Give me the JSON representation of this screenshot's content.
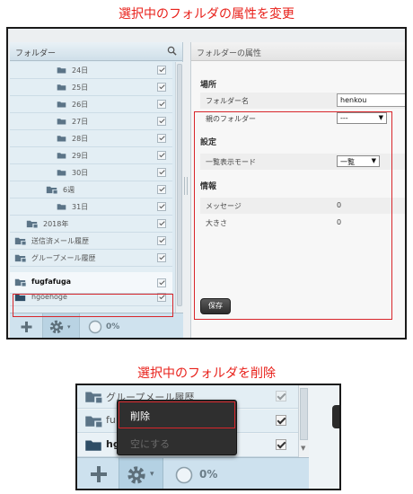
{
  "captions": {
    "top": "選択中のフォルダの属性を変更",
    "bottom": "選択中のフォルダを削除"
  },
  "left_panel": {
    "title": "フォルダー",
    "items": [
      {
        "label": "24日",
        "indent": 2,
        "icon": "folder",
        "checked": true
      },
      {
        "label": "25日",
        "indent": 2,
        "icon": "folder",
        "checked": true
      },
      {
        "label": "26日",
        "indent": 2,
        "icon": "folder",
        "checked": true
      },
      {
        "label": "27日",
        "indent": 2,
        "icon": "folder",
        "checked": true
      },
      {
        "label": "28日",
        "indent": 2,
        "icon": "folder",
        "checked": true
      },
      {
        "label": "29日",
        "indent": 2,
        "icon": "folder",
        "checked": true
      },
      {
        "label": "30日",
        "indent": 2,
        "icon": "folder",
        "checked": true
      },
      {
        "label": "6週",
        "indent": 1,
        "icon": "folder-group",
        "checked": true
      },
      {
        "label": "31日",
        "indent": 2,
        "icon": "folder",
        "checked": true
      },
      {
        "label": "2018年",
        "indent": 0,
        "icon": "folder-group",
        "checked": true
      },
      {
        "label": "送信済メール履歴",
        "indent": -1,
        "icon": "folder-group",
        "checked": true
      },
      {
        "label": "グループメール履歴",
        "indent": -1,
        "icon": "folder-group",
        "checked": true
      },
      {
        "label": "fugfafuga",
        "indent": -1,
        "icon": "folder-group",
        "checked": true,
        "selected": true
      },
      {
        "label": "hgoehoge",
        "indent": -1,
        "icon": "folder-dark",
        "checked": true
      }
    ],
    "footer": {
      "percent": "0%"
    }
  },
  "right_panel": {
    "title": "フォルダーの属性",
    "section_location": "場所",
    "folder_name_label": "フォルダー名",
    "folder_name_value": "henkou",
    "parent_folder_label": "親のフォルダー",
    "parent_folder_value": "---",
    "section_settings": "設定",
    "list_mode_label": "一覧表示モード",
    "list_mode_value": "一覧",
    "section_info": "情報",
    "message_label": "メッセージ",
    "message_value": "0",
    "size_label": "大きさ",
    "size_value": "0",
    "save_label": "保存"
  },
  "panel2": {
    "rows": [
      {
        "label": "グループメール履歴",
        "checked": true,
        "faded": true
      },
      {
        "label": "fu",
        "checked": true
      },
      {
        "label": "hg",
        "checked": true
      }
    ],
    "menu": {
      "delete": "削除",
      "empty": "空にする"
    },
    "footer": {
      "percent": "0%"
    }
  },
  "colors": {
    "caption": "#e8201a",
    "highlight": "#d8262b",
    "panel_blue": "#dceaf2"
  }
}
